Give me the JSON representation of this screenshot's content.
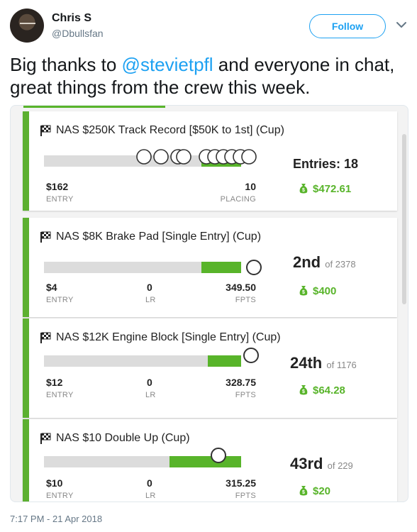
{
  "user": {
    "name": "Chris S",
    "handle": "@Dbullsfan",
    "follow_label": "Follow"
  },
  "tweet": {
    "text_before": "Big thanks to ",
    "mention": "@stevietpfl",
    "text_after": " and everyone in chat, great things from the crew this week."
  },
  "colors": {
    "twitter_blue": "#1da1f2",
    "accent_green": "#58b42a",
    "card_border_green": "#5cb030"
  },
  "contests": [
    {
      "title": "NAS $250K Track Record [$50K to 1st] (Cup)",
      "entry_value": "$162",
      "entry_label": "ENTRY",
      "placing_value": "10",
      "placing_label": "PLACING",
      "entries_text": "Entries: 18",
      "prize": "$472.61",
      "icon": "checkered-flag-icon",
      "lineup_circle_count": 10,
      "progress": 0.27
    },
    {
      "title": "NAS $8K Brake Pad [Single Entry] (Cup)",
      "entry_value": "$4",
      "entry_label": "ENTRY",
      "lr_value": "0",
      "lr_label": "LR",
      "fpts_value": "349.50",
      "fpts_label": "FPTS",
      "rank": "2nd",
      "rank_of": "of 2378",
      "prize": "$400",
      "icon": "checkered-flag-icon",
      "progress": 0.27
    },
    {
      "title": "NAS $12K Engine Block [Single Entry] (Cup)",
      "entry_value": "$12",
      "entry_label": "ENTRY",
      "lr_value": "0",
      "lr_label": "LR",
      "fpts_value": "328.75",
      "fpts_label": "FPTS",
      "rank": "24th",
      "rank_of": "of 1176",
      "prize": "$64.28",
      "icon": "checkered-flag-icon",
      "progress": 0.23
    },
    {
      "title": "NAS $10 Double Up (Cup)",
      "entry_value": "$10",
      "entry_label": "ENTRY",
      "lr_value": "0",
      "lr_label": "LR",
      "fpts_value": "315.25",
      "fpts_label": "FPTS",
      "rank": "43rd",
      "rank_of": "of 229",
      "prize": "$20",
      "icon": "checkered-flag-icon",
      "progress": 0.45
    }
  ],
  "timestamp": "7:17 PM - 21 Apr 2018"
}
